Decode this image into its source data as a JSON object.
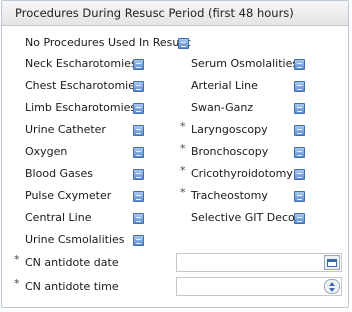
{
  "panel": {
    "title": "Procedures During Resusc Period (first 48 hours)"
  },
  "procedures": {
    "none": "No Procedures Used In Resusc",
    "left": [
      "Neck Escharotomies",
      "Chest Escharotomies",
      "Limb Escharotomies",
      "Urine Catheter",
      "Oxygen",
      "Blood Gases",
      "Pulse Cxymeter",
      "Central Line",
      "Urine Csmolalities"
    ],
    "right": [
      "Serum Osmolalities",
      "Arterial Line",
      "Swan-Ganz",
      "Laryngoscopy",
      "Bronchoscopy",
      "Cricothyroidotomy",
      "Tracheostomy",
      "Selective GIT Decon"
    ]
  },
  "required_marker": "*",
  "fields": {
    "date_label": "CN antidote date",
    "date_value": "",
    "time_label": "CN antidote time",
    "time_value": ""
  },
  "icons": {
    "checkbox": "checkbox-icon",
    "calendar": "calendar-icon",
    "spinner": "spinner-icon"
  }
}
